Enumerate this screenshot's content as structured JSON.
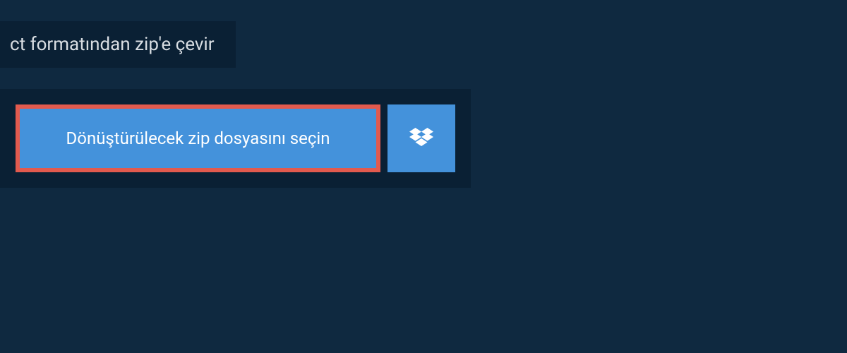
{
  "tab": {
    "label": "ct formatından zip'e çevir"
  },
  "panel": {
    "select_button_label": "Dönüştürülecek zip dosyasını seçin"
  }
}
